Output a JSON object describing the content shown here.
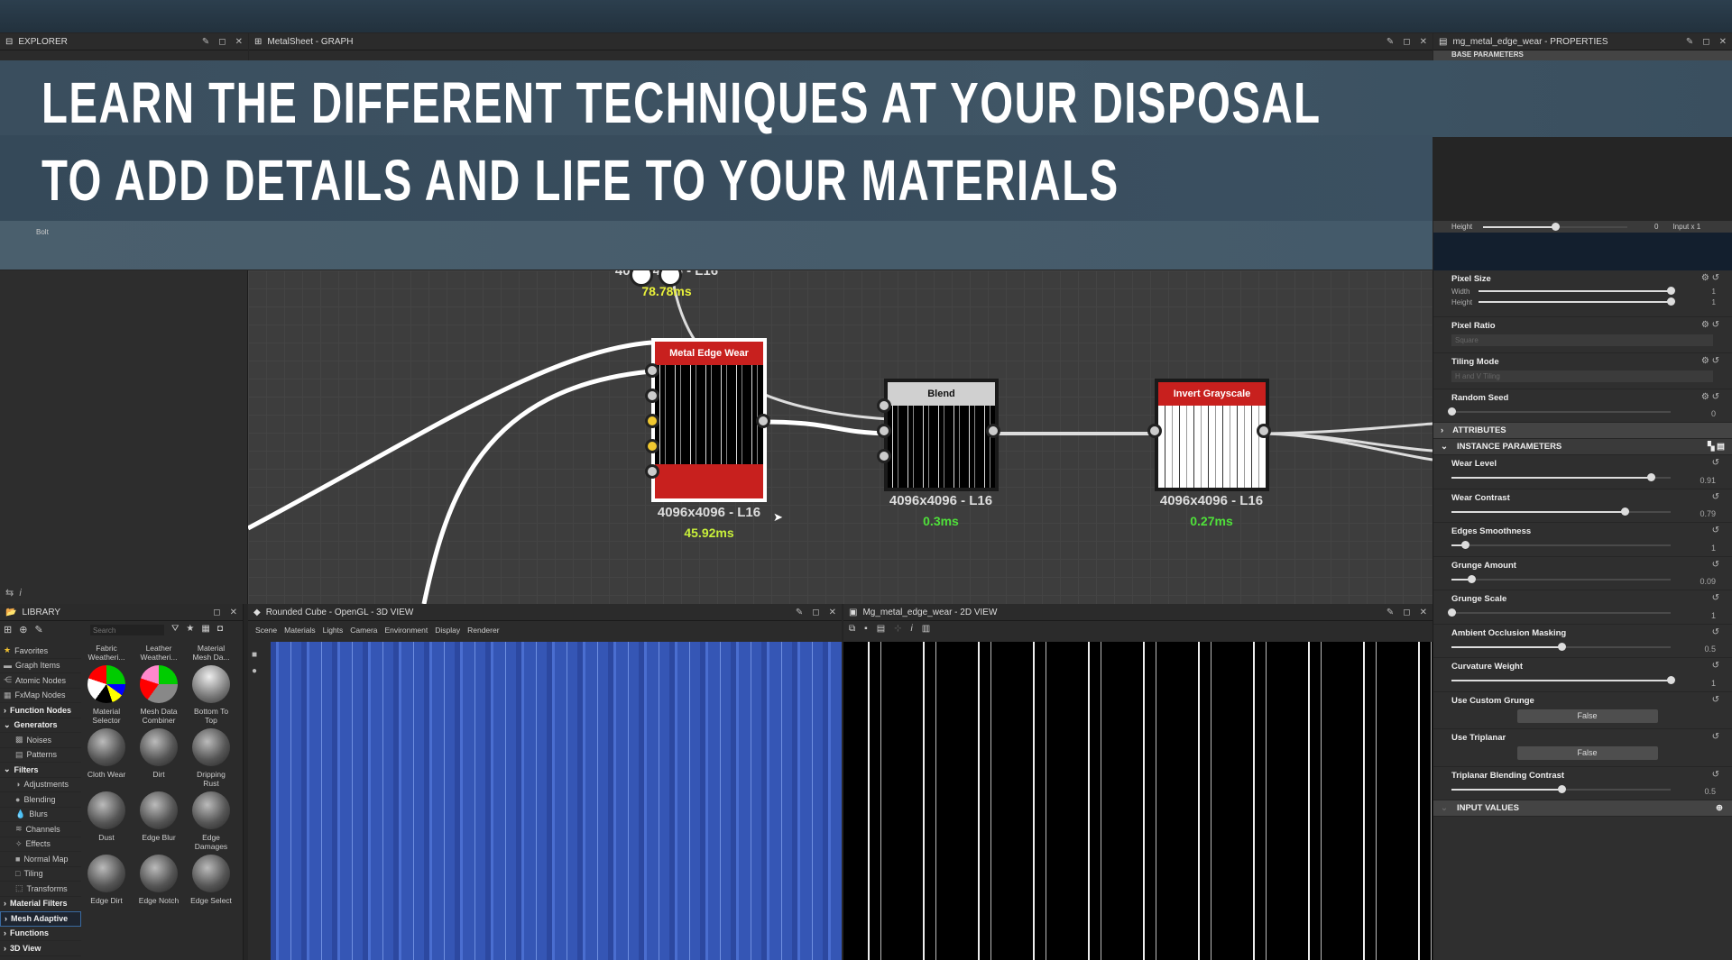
{
  "banner": {
    "line1": "LEARN THE DIFFERENT TECHNIQUES AT YOUR DISPOSAL",
    "line2": "TO ADD DETAILS AND LIFE TO YOUR MATERIALS"
  },
  "panels": {
    "explorer": "EXPLORER",
    "explorer_item": "Bolt",
    "graph": "MetalSheet - GRAPH",
    "properties": "mg_metal_edge_wear - PROPERTIES",
    "base_parameters": "BASE PARAMETERS",
    "library": "LIBRARY",
    "view3d": "Rounded Cube - OpenGL - 3D VIEW",
    "view2d": "Mg_metal_edge_wear - 2D VIEW"
  },
  "view3d_menu": [
    "Scene",
    "Materials",
    "Lights",
    "Camera",
    "Environment",
    "Display",
    "Renderer"
  ],
  "graph": {
    "top_node": {
      "size": "4096x4096 - L16",
      "time": "78.78ms"
    },
    "nodes": [
      {
        "title": "Metal Edge Wear",
        "size": "4096x4096 - L16",
        "time": "45.92ms",
        "header_color": "#c8201e"
      },
      {
        "title": "Blend",
        "size": "4096x4096 - L16",
        "time": "0.3ms",
        "header_color": "#d0d0d0"
      },
      {
        "title": "Invert Grayscale",
        "size": "4096x4096 - L16",
        "time": "0.27ms",
        "header_color": "#c8201e"
      }
    ],
    "colors": {
      "time_yellow": "#e8f03a",
      "time_green": "#4fe03a"
    }
  },
  "properties": {
    "output_height": {
      "label": "Height",
      "value": "0",
      "fraction": 0.5,
      "suffix": "Input x 1"
    },
    "pixel_size": {
      "label": "Pixel Size",
      "width_label": "Width",
      "width_value": "1",
      "height_label": "Height",
      "height_value": "1"
    },
    "pixel_ratio": {
      "label": "Pixel Ratio",
      "value": "Square"
    },
    "tiling_mode": {
      "label": "Tiling Mode",
      "value": "H and V Tiling"
    },
    "random_seed": {
      "label": "Random Seed",
      "value": "0",
      "fraction": 0
    },
    "attributes": "ATTRIBUTES",
    "instance_parameters": "INSTANCE PARAMETERS",
    "params": [
      {
        "label": "Wear Level",
        "value": "0.91",
        "fraction": 0.91
      },
      {
        "label": "Wear Contrast",
        "value": "0.79",
        "fraction": 0.79
      },
      {
        "label": "Edges Smoothness",
        "value": "1",
        "fraction": 0.06
      },
      {
        "label": "Grunge Amount",
        "value": "0.09",
        "fraction": 0.09
      },
      {
        "label": "Grunge Scale",
        "value": "1",
        "fraction": 0
      },
      {
        "label": "Ambient Occlusion Masking",
        "value": "0.5",
        "fraction": 0.5
      },
      {
        "label": "Curvature Weight",
        "value": "1",
        "fraction": 1
      }
    ],
    "use_custom_grunge": {
      "label": "Use Custom Grunge",
      "value": "False"
    },
    "use_triplanar": {
      "label": "Use Triplanar",
      "value": "False"
    },
    "triplanar_contrast": {
      "label": "Triplanar Blending Contrast",
      "value": "0.5",
      "fraction": 0.5
    },
    "input_values": "INPUT VALUES"
  },
  "library": {
    "search_placeholder": "Search",
    "tree": [
      {
        "label": "Favorites",
        "icon": "star"
      },
      {
        "label": "Graph Items",
        "icon": "comment"
      },
      {
        "label": "Atomic Nodes",
        "icon": "nodes"
      },
      {
        "label": "FxMap Nodes",
        "icon": "grid"
      },
      {
        "label": "Function Nodes",
        "bold": true,
        "arrow": "›"
      },
      {
        "label": "Generators",
        "bold": true,
        "arrow": "⌄"
      },
      {
        "label": "Noises",
        "indent": true,
        "icon": "noise"
      },
      {
        "label": "Patterns",
        "indent": true,
        "icon": "pattern"
      },
      {
        "label": "Filters",
        "bold": true,
        "arrow": "⌄"
      },
      {
        "label": "Adjustments",
        "indent": true,
        "icon": "contrast"
      },
      {
        "label": "Blending",
        "indent": true,
        "icon": "blend"
      },
      {
        "label": "Blurs",
        "indent": true,
        "icon": "drop"
      },
      {
        "label": "Channels",
        "indent": true,
        "icon": "layers"
      },
      {
        "label": "Effects",
        "indent": true,
        "icon": "wand"
      },
      {
        "label": "Normal Map",
        "indent": true,
        "icon": "normal"
      },
      {
        "label": "Tiling",
        "indent": true,
        "icon": "tile"
      },
      {
        "label": "Transforms",
        "indent": true,
        "icon": "transform"
      },
      {
        "label": "Material Filters",
        "bold": true,
        "arrow": "›"
      },
      {
        "label": "Mesh Adaptive",
        "bold": true,
        "arrow": "›",
        "selected": true
      },
      {
        "label": "Functions",
        "bold": true,
        "arrow": "›"
      },
      {
        "label": "3D View",
        "bold": true,
        "arrow": "›"
      }
    ],
    "items": [
      "Fabric Weatheri...",
      "Leather Weatheri...",
      "Material Mesh Da...",
      "Material Selector",
      "Mesh Data Combiner",
      "Bottom To Top",
      "Cloth Wear",
      "Dirt",
      "Dripping Rust",
      "Dust",
      "Edge Blur",
      "Edge Damages",
      "Edge Dirt",
      "Edge Notch",
      "Edge Select"
    ]
  }
}
